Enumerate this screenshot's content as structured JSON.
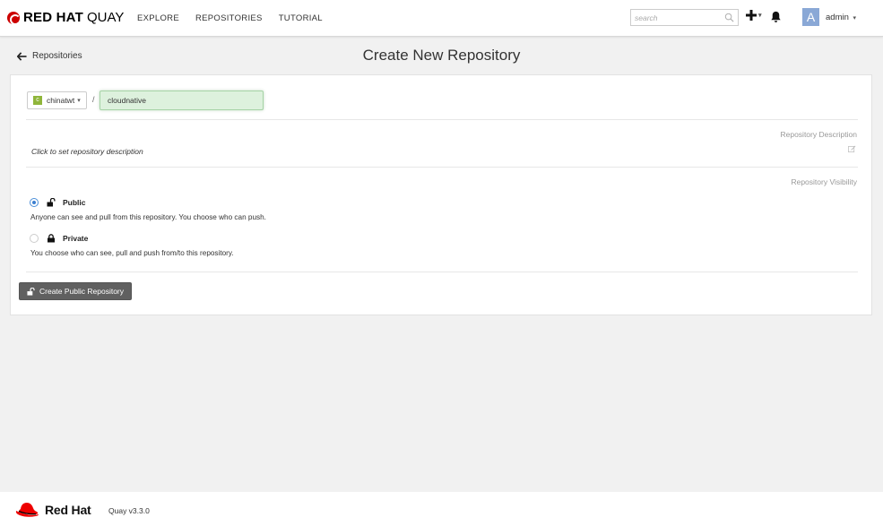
{
  "header": {
    "brand": "RED HAT",
    "brand_product": "QUAY",
    "nav": [
      "EXPLORE",
      "REPOSITORIES",
      "TUTORIAL"
    ],
    "search_placeholder": "search",
    "user_initial": "A",
    "user_name": "admin"
  },
  "subheader": {
    "back_label": "Repositories",
    "title": "Create New Repository"
  },
  "form": {
    "namespace": "chinatwt",
    "namespace_initial": "c",
    "separator": "/",
    "repo_name": "cloudnative",
    "description_label": "Repository Description",
    "description_prompt": "Click to set repository description",
    "visibility_label": "Repository Visibility",
    "public_title": "Public",
    "public_desc": "Anyone can see and pull from this repository. You choose who can push.",
    "private_title": "Private",
    "private_desc": "You choose who can see, pull and push from/to this repository.",
    "selected_visibility": "public",
    "create_button": "Create Public Repository"
  },
  "footer": {
    "brand": "Red Hat",
    "version": "Quay v3.3.0"
  },
  "colors": {
    "brand_red": "#cc0000",
    "radio_selected": "#3c7fd0",
    "repo_input_bg": "#ddf1dd",
    "button_bg": "#606060"
  }
}
